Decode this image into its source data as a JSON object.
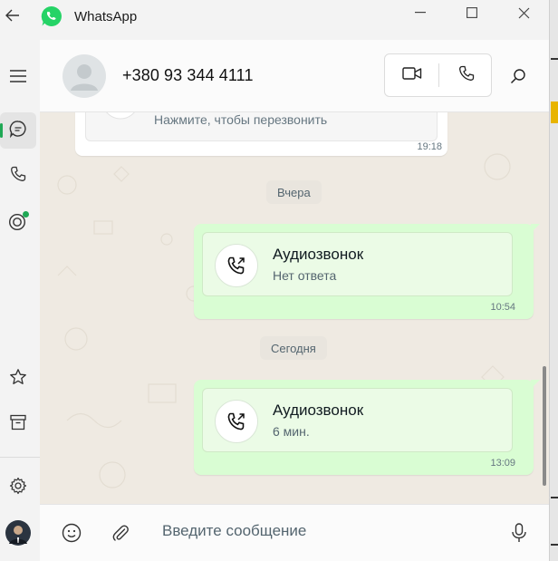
{
  "window": {
    "app_name": "WhatsApp",
    "accent": "#1fa855"
  },
  "icons": {
    "back": "back-arrow-icon",
    "logo": "whatsapp-logo-icon",
    "minimize": "minimize-icon",
    "maximize": "maximize-icon",
    "close": "close-icon",
    "menu": "hamburger-menu-icon",
    "chats": "chat-bubble-icon",
    "calls": "phone-icon",
    "status": "status-ring-icon",
    "starred": "star-icon",
    "archived": "archive-icon",
    "settings": "gear-icon",
    "video_call": "video-camera-icon",
    "voice_call": "phone-icon",
    "search": "search-icon",
    "emoji": "emoji-icon",
    "attach": "paperclip-icon",
    "mic": "microphone-icon"
  },
  "header": {
    "contact_name": "+380 93 344 4111"
  },
  "messages": [
    {
      "direction": "in",
      "text": "Нажмите, чтобы перезвонить",
      "time": "19:18"
    },
    {
      "type": "date",
      "text": "Вчера"
    },
    {
      "direction": "out",
      "title": "Аудиозвонок",
      "subtitle": "Нет ответа",
      "time": "10:54"
    },
    {
      "type": "date",
      "text": "Сегодня"
    },
    {
      "direction": "out",
      "title": "Аудиозвонок",
      "subtitle": "6 мин.",
      "time": "13:09"
    }
  ],
  "composer": {
    "placeholder": "Введите сообщение"
  },
  "colors": {
    "chat_bg": "#efeae2",
    "outgoing_bubble": "#d9fdd3",
    "incoming_bubble": "#ffffff",
    "missed_call": "#d93a3a"
  }
}
